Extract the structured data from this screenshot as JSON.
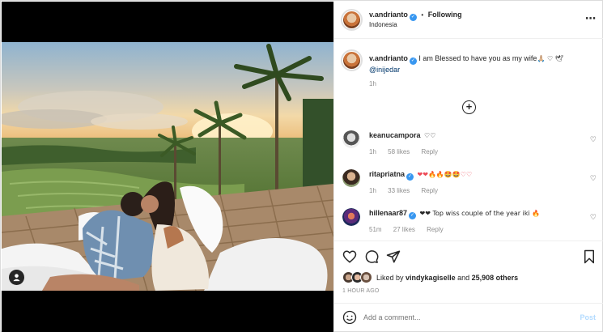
{
  "post": {
    "author": "v.andrianto",
    "location": "Indonesia",
    "follow_status": "Following",
    "separator": "•",
    "more_glyph": "⋯"
  },
  "caption": {
    "author": "v.andrianto",
    "text": "I am Blessed to have you as my wife",
    "emoji": "🙏🏼 ♡ 🕊",
    "mention": "@inijedar",
    "time": "1h"
  },
  "load_more_glyph": "+",
  "comments": [
    {
      "user": "keanucampora",
      "verified": false,
      "text": "♡♡",
      "time": "1h",
      "likes": "58 likes",
      "reply": "Reply"
    },
    {
      "user": "ritapriatna",
      "verified": true,
      "text": "❤❤🔥🔥🤩🤩♡♡",
      "time": "1h",
      "likes": "33 likes",
      "reply": "Reply"
    },
    {
      "user": "hillenaar87",
      "verified": true,
      "text": "❤❤ Top wiss couple of the year iki 🔥",
      "time": "51m",
      "likes": "27 likes",
      "reply": "Reply"
    }
  ],
  "likes": {
    "prefix": "Liked by",
    "user": "vindykagiselle",
    "and": "and",
    "others": "25,908 others"
  },
  "timestamp": "1 HOUR AGO",
  "add_comment": {
    "placeholder": "Add a comment...",
    "post_label": "Post"
  },
  "colors": {
    "verified": "#3897f0",
    "link": "#00376b",
    "post_disabled": "#b3dbff",
    "red_heart": "#ed4956"
  }
}
